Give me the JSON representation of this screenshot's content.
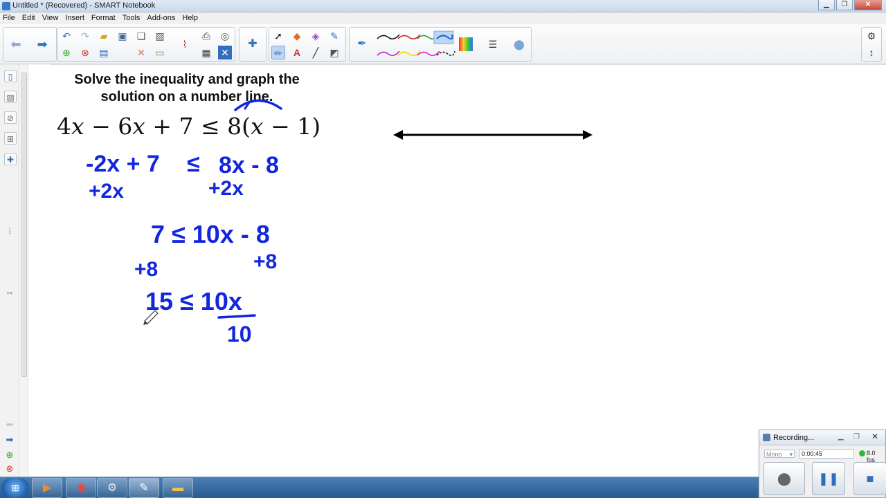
{
  "window": {
    "title": "Untitled * (Recovered) - SMART Notebook",
    "min_glyph": "▁",
    "max_glyph": "❐",
    "close_glyph": "✕"
  },
  "menu": [
    "File",
    "Edit",
    "View",
    "Insert",
    "Format",
    "Tools",
    "Add-ons",
    "Help"
  ],
  "toolbar": {
    "icons": [
      "back-arrow-icon",
      "forward-arrow-icon",
      "undo-icon",
      "redo-icon",
      "open-folder-icon",
      "screen-shade-icon",
      "paste-icon",
      "insert-picture-icon",
      "add-page-icon",
      "delete-page-icon",
      "save-icon",
      "delete-icon",
      "display-screen-icon",
      "clear-ink-icon",
      "table-icon",
      "close-box-icon",
      "screen-capture-icon",
      "zoom-icon",
      "add-ons-icon",
      "select-arrow-icon",
      "shapes-icon",
      "eraser-icon",
      "magic-pen-icon",
      "creative-pen-icon",
      "text-icon",
      "line-icon",
      "fill-icon",
      "pen-icon",
      "pen-style-icon",
      "color-palette-icon",
      "line-style-icon",
      "transparency-icon",
      "settings-gear-icon",
      "move-toolbar-icon"
    ],
    "selected_pen_color": "#1a5fd0"
  },
  "side_tabs": [
    "page-sorter-icon",
    "gallery-icon",
    "attachments-icon",
    "properties-icon",
    "add-ons-tab-icon"
  ],
  "page": {
    "prompt_line1": "Solve the inequality and graph the",
    "prompt_line2": "solution on a number line.",
    "equation": {
      "lhs_a": "4",
      "var": "x",
      "op1": " − 6",
      "op2": " + 7 ≤ 8(",
      "op3": " − 1)"
    },
    "ink_color": "#1226e0",
    "handwritten": {
      "step1_left": "-2x + 7",
      "step1_le": "≤",
      "step1_right": "8x - 8",
      "step2_left": "+2x",
      "step2_right": "+2x",
      "step3": "7 ≤ 10x - 8",
      "step4_left": "+8",
      "step4_right": "+8",
      "step5": "15 ≤ 10x",
      "step5_den": "10"
    }
  },
  "taskbar": {
    "items": [
      "windows-start-icon",
      "media-player-icon",
      "chrome-icon",
      "control-panel-icon",
      "notebook-icon",
      "folder-icon"
    ]
  },
  "recording": {
    "label": "Recording...",
    "mic": "Mono",
    "time": "0:00:45",
    "fps": "8.0 fps"
  }
}
